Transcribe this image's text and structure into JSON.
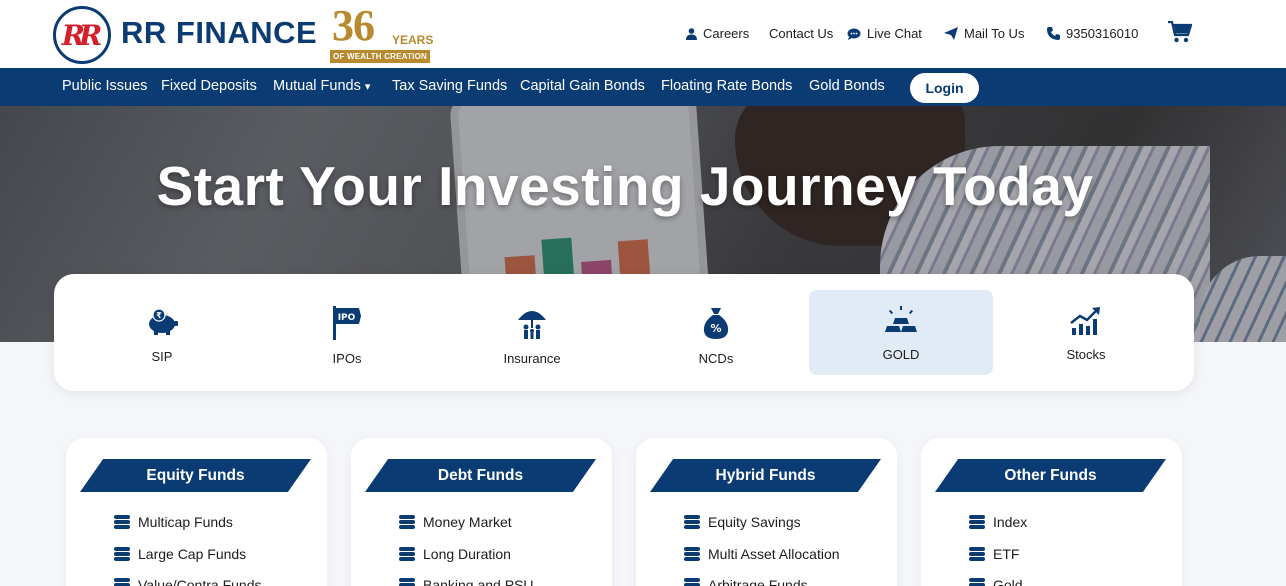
{
  "header": {
    "logo_letters": "RR",
    "brand": "RR FINANCE",
    "badge": {
      "number": "36",
      "word": "YEARS",
      "tagline": "OF WEALTH CREATION"
    },
    "links": [
      {
        "label": "Careers",
        "icon": "user-icon"
      },
      {
        "label": "Contact Us",
        "icon": ""
      },
      {
        "label": "Live Chat",
        "icon": "chat-icon"
      },
      {
        "label": "Mail To Us",
        "icon": "paper-plane-icon"
      },
      {
        "label": "9350316010",
        "icon": "phone-icon"
      }
    ],
    "cart_icon": "cart-icon"
  },
  "nav": {
    "items": [
      "Public Issues",
      "Fixed Deposits",
      "Mutual Funds",
      "Tax Saving Funds",
      "Capital Gain Bonds",
      "Floating Rate Bonds",
      "Gold Bonds"
    ],
    "mutual_funds_caret": "▾",
    "login": "Login"
  },
  "hero": {
    "title": "Start Your Investing Journey Today"
  },
  "categories": [
    {
      "label": "SIP",
      "icon": "piggy-bank-icon"
    },
    {
      "label": "IPOs",
      "icon": "ipo-sign-icon"
    },
    {
      "label": "Insurance",
      "icon": "umbrella-family-icon"
    },
    {
      "label": "NCDs",
      "icon": "money-bag-icon"
    },
    {
      "label": "GOLD",
      "icon": "gold-bars-icon",
      "active": true
    },
    {
      "label": "Stocks",
      "icon": "chart-growth-icon"
    }
  ],
  "funds": [
    {
      "title": "Equity Funds",
      "items": [
        "Multicap Funds",
        "Large Cap Funds",
        "Value/Contra Funds"
      ]
    },
    {
      "title": "Debt Funds",
      "items": [
        "Money Market",
        "Long Duration",
        "Banking and PSU"
      ]
    },
    {
      "title": "Hybrid Funds",
      "items": [
        "Equity Savings",
        "Multi Asset Allocation",
        "Arbitrage Funds"
      ]
    },
    {
      "title": "Other Funds",
      "items": [
        "Index",
        "ETF",
        "Gold"
      ]
    }
  ],
  "colors": {
    "primary": "#0b3b73",
    "accent_red": "#d3202a",
    "gold": "#b8892d",
    "active_tab": "#e1ebf5"
  }
}
